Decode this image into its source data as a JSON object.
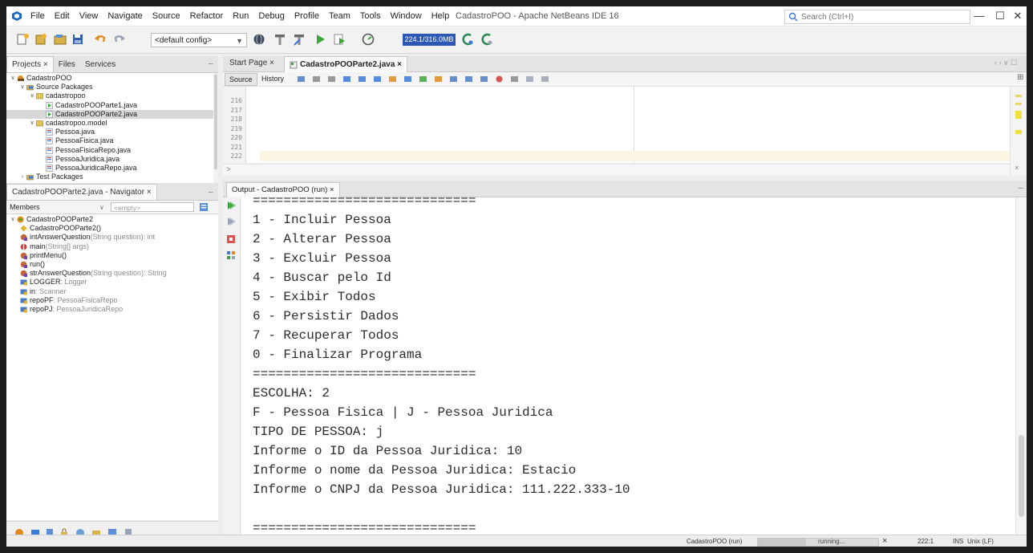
{
  "menu": [
    "File",
    "Edit",
    "View",
    "Navigate",
    "Source",
    "Refactor",
    "Run",
    "Debug",
    "Profile",
    "Team",
    "Tools",
    "Window",
    "Help"
  ],
  "window_title": "CadastroPOO - Apache NetBeans IDE 16",
  "search_placeholder": "Search (Ctrl+I)",
  "window_controls": {
    "minimize": "—",
    "maximize": "☐",
    "close": "✕"
  },
  "toolbar": {
    "config": "<default config>",
    "memory": "224.1/316.0MB"
  },
  "projects_panel": {
    "tabs": [
      "Projects ×",
      "Files",
      "Services"
    ],
    "tree": [
      {
        "label": "CadastroPOO",
        "level": 0,
        "expanded": true,
        "icon": "project"
      },
      {
        "label": "Source Packages",
        "level": 1,
        "expanded": true,
        "icon": "folder"
      },
      {
        "label": "cadastropoo",
        "level": 2,
        "expanded": true,
        "icon": "package"
      },
      {
        "label": "CadastroPOOParte1.java",
        "level": 3,
        "icon": "java-main"
      },
      {
        "label": "CadastroPOOParte2.java",
        "level": 3,
        "icon": "java-main",
        "selected": true
      },
      {
        "label": "cadastropoo.model",
        "level": 2,
        "expanded": true,
        "icon": "package"
      },
      {
        "label": "Pessoa.java",
        "level": 3,
        "icon": "java"
      },
      {
        "label": "PessoaFisica.java",
        "level": 3,
        "icon": "java"
      },
      {
        "label": "PessoaFisicaRepo.java",
        "level": 3,
        "icon": "java"
      },
      {
        "label": "PessoaJuridica.java",
        "level": 3,
        "icon": "java"
      },
      {
        "label": "PessoaJuridicaRepo.java",
        "level": 3,
        "icon": "java"
      },
      {
        "label": "Test Packages",
        "level": 1,
        "expanded": false,
        "icon": "folder"
      }
    ]
  },
  "navigator": {
    "title": "CadastroPOOParte2.java - Navigator ×",
    "members": "Members",
    "filter": "<empty>",
    "root": "CadastroPOOParte2",
    "members_list": [
      {
        "name": "CadastroPOOParte2()",
        "type": "",
        "icon": "constructor"
      },
      {
        "name": "intAnswerQuestion",
        "params": "(String question)",
        "type": " : int",
        "icon": "method"
      },
      {
        "name": "main",
        "params": "(String[] args)",
        "type": "",
        "icon": "static-method"
      },
      {
        "name": "printMenu()",
        "params": "",
        "type": "",
        "icon": "method"
      },
      {
        "name": "run()",
        "params": "",
        "type": "",
        "icon": "method"
      },
      {
        "name": "strAnswerQuestion",
        "params": "(String question)",
        "type": " : String",
        "icon": "method"
      },
      {
        "name": "LOGGER",
        "params": "",
        "type": " : Logger",
        "icon": "field"
      },
      {
        "name": "in",
        "params": "",
        "type": " : Scanner",
        "icon": "field"
      },
      {
        "name": "repoPF",
        "params": "",
        "type": " : PessoaFisicaRepo",
        "icon": "field"
      },
      {
        "name": "repoPJ",
        "params": "",
        "type": " : PessoaJuridicaRepo",
        "icon": "field"
      }
    ]
  },
  "editor": {
    "tabs": [
      "Start Page ×",
      "CadastroPOOParte2.java ×"
    ],
    "source_tab": "Source",
    "history_tab": "History",
    "line_numbers": [
      "216",
      "217",
      "218",
      "219",
      "220",
      "221",
      "222"
    ],
    "breadcrumb": ">"
  },
  "output": {
    "tab": "Output - CadastroPOO (run) ×",
    "lines": [
      "=============================",
      "1 - Incluir Pessoa",
      "2 - Alterar Pessoa",
      "3 - Excluir Pessoa",
      "4 - Buscar pelo Id",
      "5 - Exibir Todos",
      "6 - Persistir Dados",
      "7 - Recuperar Todos",
      "0 - Finalizar Programa",
      "=============================",
      "ESCOLHA: 2",
      "F - Pessoa Fisica | J - Pessoa Juridica",
      "TIPO DE PESSOA: j",
      "Informe o ID da Pessoa Juridica: 10",
      "Informe o nome da Pessoa Juridica: Estacio",
      "Informe o CNPJ da Pessoa Juridica: 111.222.333-10",
      "",
      "============================="
    ]
  },
  "status": {
    "task": "CadastroPOO (run)",
    "progress_text": "running...",
    "progress_fraction": 0.4,
    "cancel": "×",
    "position": "222:1",
    "mode": "INS",
    "line_ending": "Unix (LF)"
  }
}
